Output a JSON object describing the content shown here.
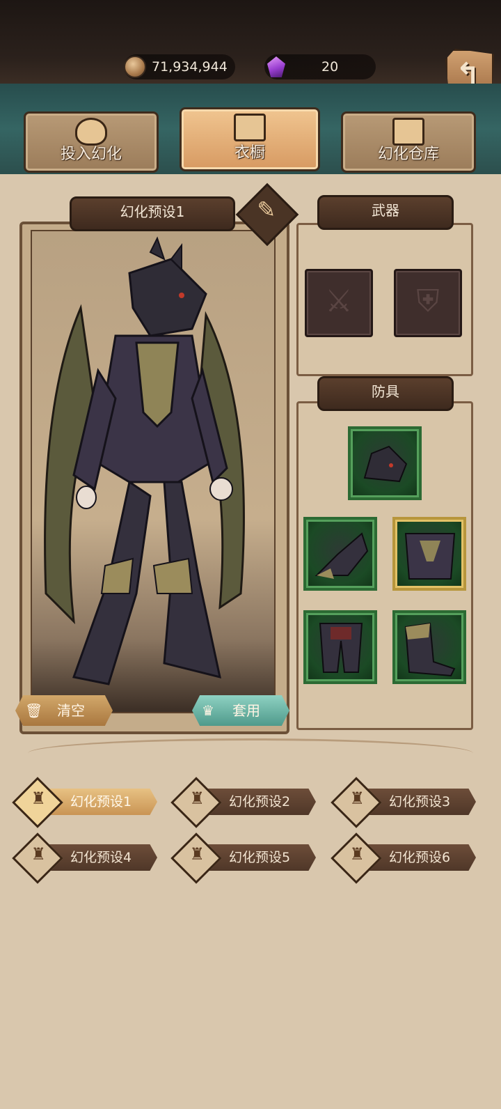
{
  "currency": {
    "coins": "71,934,944",
    "gems": "20"
  },
  "tabs": [
    {
      "label": "投入幻化",
      "icon": "mask-icon"
    },
    {
      "label": "衣橱",
      "icon": "armor-icon"
    },
    {
      "label": "幻化仓库",
      "icon": "wardrobe-icon"
    }
  ],
  "preset_panel": {
    "title": "幻化预设1",
    "clear_label": "清空",
    "apply_label": "套用"
  },
  "weapon_panel": {
    "title": "武器"
  },
  "armor_panel": {
    "title": "防具"
  },
  "presets": [
    "幻化预设1",
    "幻化预设2",
    "幻化预设3",
    "幻化预设4",
    "幻化预设5",
    "幻化预设6"
  ],
  "colors": {
    "accent": "#d79a62",
    "teal": "#5fb4a4",
    "equip_green": "#2c6a33",
    "equip_gold": "#b7963c"
  }
}
